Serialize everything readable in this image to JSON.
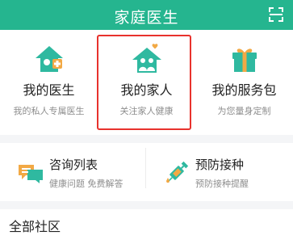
{
  "header": {
    "title": "家庭医生",
    "scan_icon": "scan-icon",
    "background": "#25b58f"
  },
  "cards": [
    {
      "label": "我的医生",
      "sub": "我的私人专属医生",
      "icon": "doctor-house-icon"
    },
    {
      "label": "我的家人",
      "sub": "关注家人健康",
      "icon": "family-house-icon"
    },
    {
      "label": "我的服务包",
      "sub": "为您量身定制",
      "icon": "gift-icon"
    }
  ],
  "highlight": {
    "color": "#e8322d",
    "target": "我的家人"
  },
  "tiles": [
    {
      "label": "咨询列表",
      "sub": "健康问题 免费解答",
      "icon": "chat-bubbles-icon"
    },
    {
      "label": "预防接种",
      "sub": "预防接种提醒",
      "icon": "syringe-icon"
    }
  ],
  "section": {
    "title": "全部社区"
  }
}
